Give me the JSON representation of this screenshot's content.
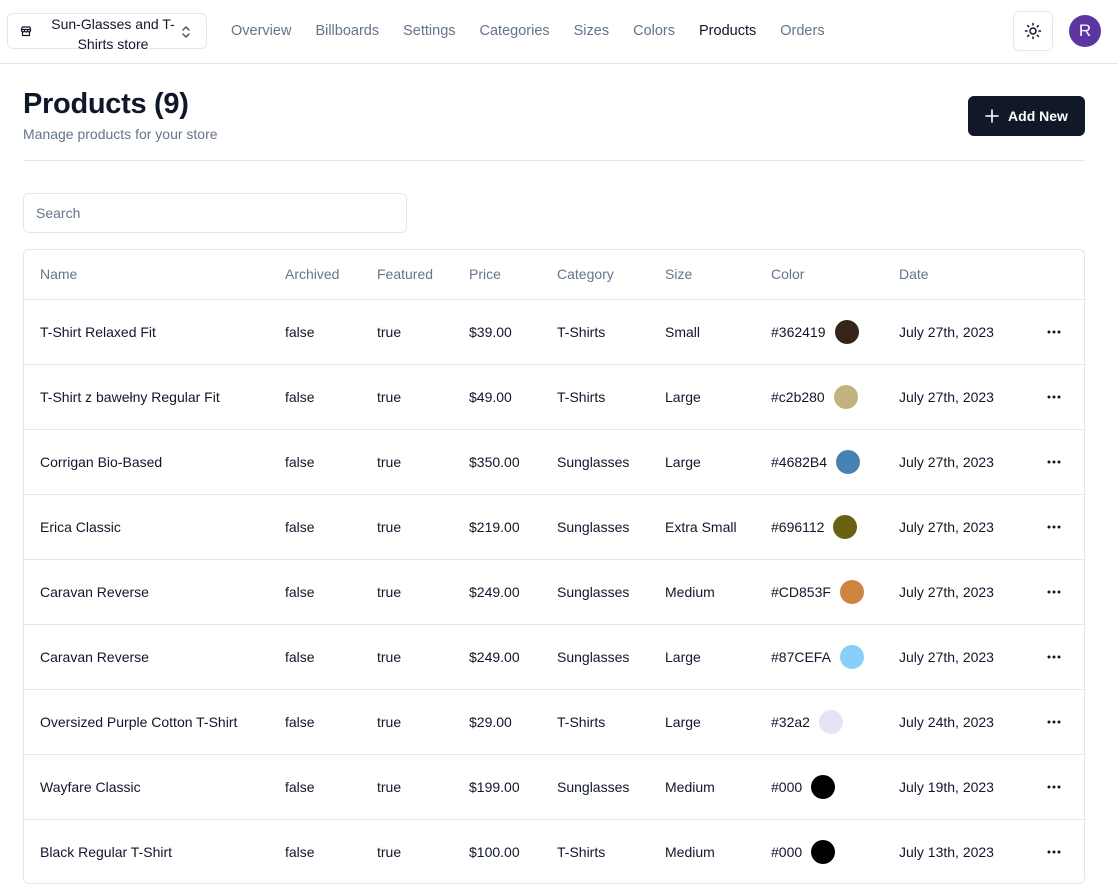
{
  "navbar": {
    "store_name": "Sun-Glasses and T-Shirts store",
    "links": [
      "Overview",
      "Billboards",
      "Settings",
      "Categories",
      "Sizes",
      "Colors",
      "Products",
      "Orders"
    ],
    "active_link": "Products",
    "avatar_initial": "R"
  },
  "header": {
    "title": "Products (9)",
    "subtitle": "Manage products for your store",
    "add_label": "Add New"
  },
  "search": {
    "placeholder": "Search",
    "value": ""
  },
  "table": {
    "columns": [
      "Name",
      "Archived",
      "Featured",
      "Price",
      "Category",
      "Size",
      "Color",
      "Date"
    ],
    "rows": [
      {
        "name": "T-Shirt Relaxed Fit",
        "archived": "false",
        "featured": "true",
        "price": "$39.00",
        "category": "T-Shirts",
        "size": "Small",
        "color": "#362419",
        "date": "July 27th, 2023"
      },
      {
        "name": "T-Shirt z bawełny Regular Fit",
        "archived": "false",
        "featured": "true",
        "price": "$49.00",
        "category": "T-Shirts",
        "size": "Large",
        "color": "#c2b280",
        "date": "July 27th, 2023"
      },
      {
        "name": "Corrigan Bio-Based",
        "archived": "false",
        "featured": "true",
        "price": "$350.00",
        "category": "Sunglasses",
        "size": "Large",
        "color": "#4682B4",
        "date": "July 27th, 2023"
      },
      {
        "name": "Erica Classic",
        "archived": "false",
        "featured": "true",
        "price": "$219.00",
        "category": "Sunglasses",
        "size": "Extra Small",
        "color": "#696112",
        "date": "July 27th, 2023"
      },
      {
        "name": "Caravan Reverse",
        "archived": "false",
        "featured": "true",
        "price": "$249.00",
        "category": "Sunglasses",
        "size": "Medium",
        "color": "#CD853F",
        "date": "July 27th, 2023"
      },
      {
        "name": "Caravan Reverse",
        "archived": "false",
        "featured": "true",
        "price": "$249.00",
        "category": "Sunglasses",
        "size": "Large",
        "color": "#87CEFA",
        "date": "July 27th, 2023"
      },
      {
        "name": "Oversized Purple Cotton T-Shirt",
        "archived": "false",
        "featured": "true",
        "price": "$29.00",
        "category": "T-Shirts",
        "size": "Large",
        "color": "#32a2",
        "date": "July 24th, 2023"
      },
      {
        "name": "Wayfare Classic",
        "archived": "false",
        "featured": "true",
        "price": "$199.00",
        "category": "Sunglasses",
        "size": "Medium",
        "color": "#000",
        "date": "July 19th, 2023"
      },
      {
        "name": "Black Regular T-Shirt",
        "archived": "false",
        "featured": "true",
        "price": "$100.00",
        "category": "T-Shirts",
        "size": "Medium",
        "color": "#000",
        "date": "July 13th, 2023"
      }
    ]
  },
  "colors": {
    "primary_button": "#111827",
    "avatar_bg": "#5b36a3",
    "muted_text": "#64748b",
    "border": "#e5e7eb"
  }
}
